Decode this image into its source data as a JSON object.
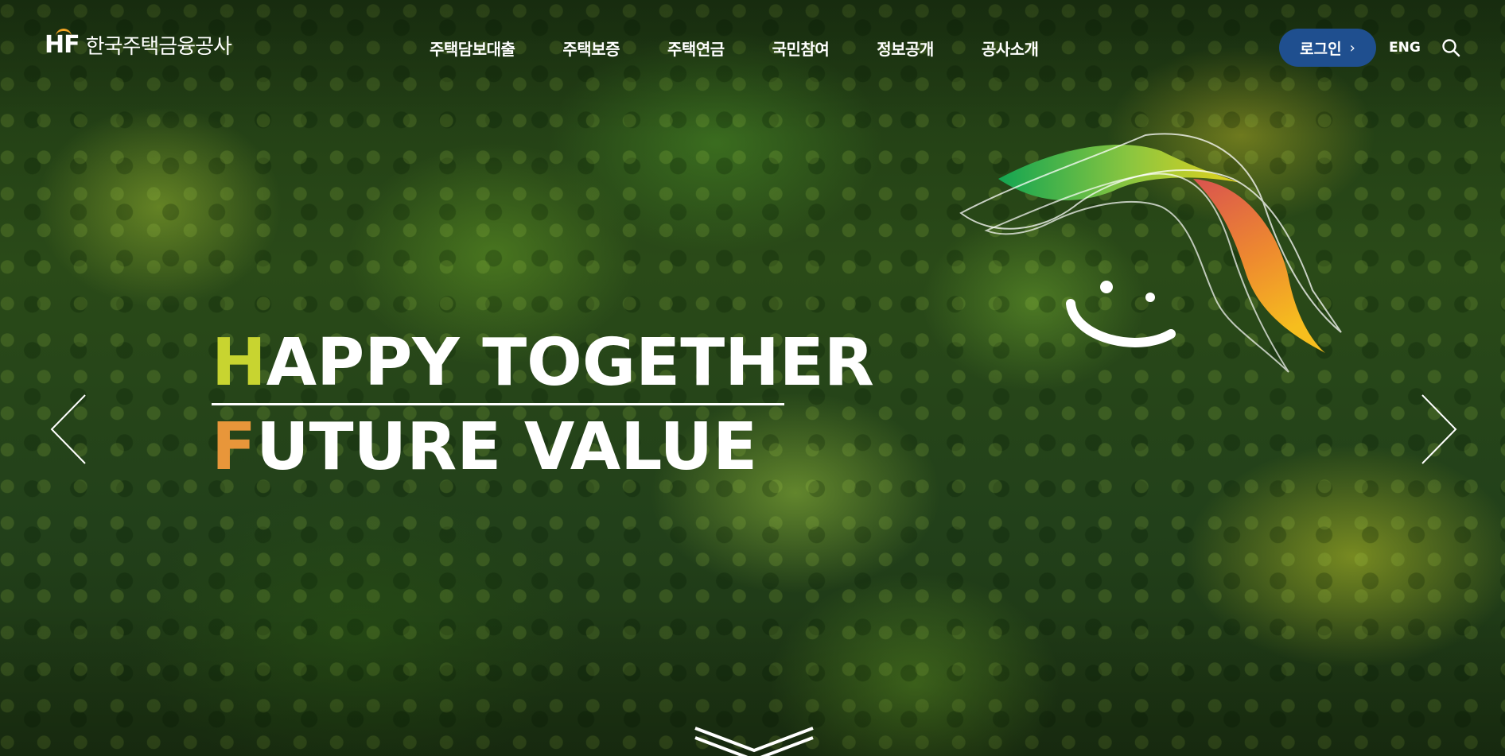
{
  "header": {
    "logo": {
      "mark": "HF",
      "name": "한국주택금융공사"
    },
    "nav": [
      {
        "label": "주택담보대출"
      },
      {
        "label": "주택보증"
      },
      {
        "label": "주택연금"
      },
      {
        "label": "국민참여"
      },
      {
        "label": "정보공개"
      },
      {
        "label": "공사소개"
      }
    ],
    "login_label": "로그인",
    "lang_label": "ENG",
    "search_icon": "search-icon"
  },
  "hero": {
    "line1_first": "H",
    "line1_rest": "APPY TOGETHER",
    "line2_first": "F",
    "line2_rest": "UTURE VALUE"
  },
  "colors": {
    "accent_h": "#c8d430",
    "accent_f": "#e8963a",
    "login_bg": "#1f4f8f"
  }
}
